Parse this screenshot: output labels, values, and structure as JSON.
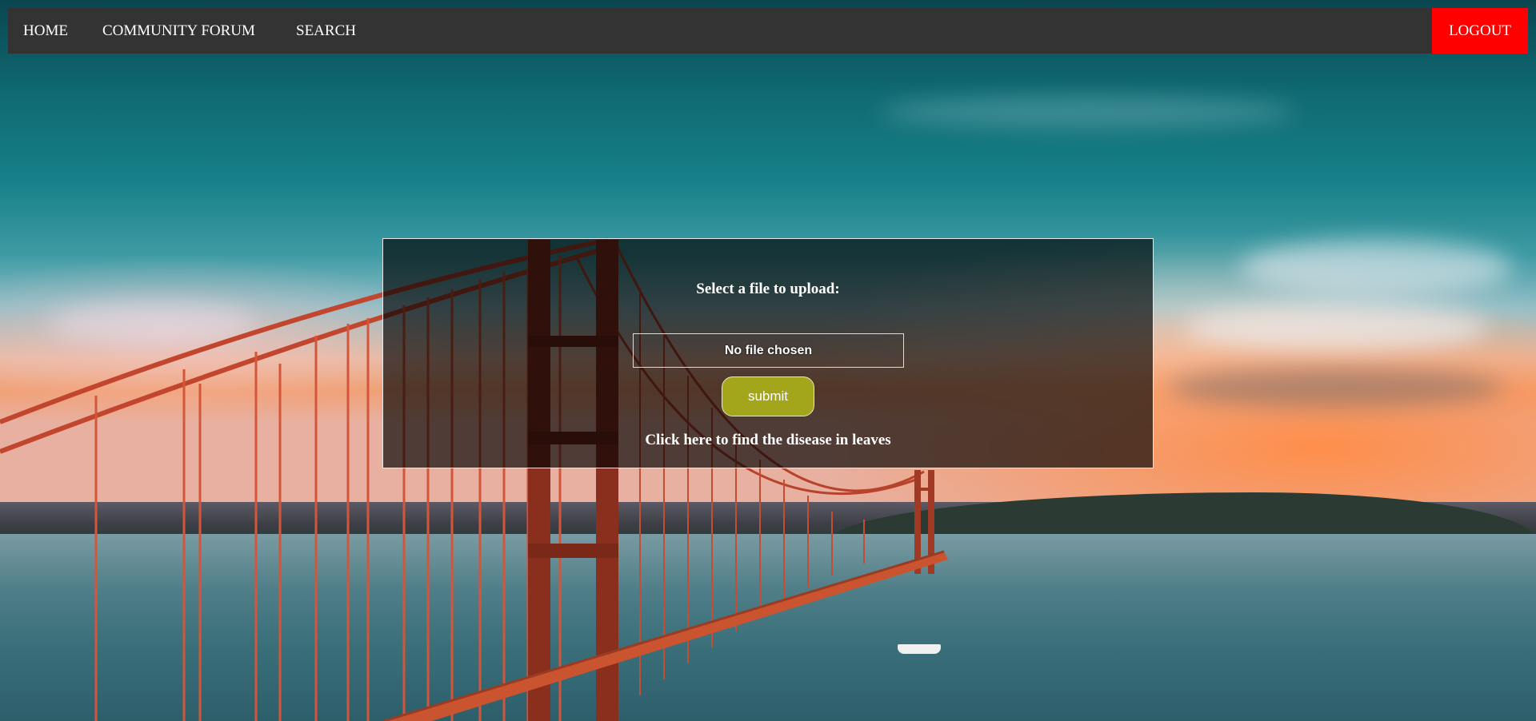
{
  "nav": {
    "home": "HOME",
    "community_forum": "COMMUNITY FORUM",
    "search": "SEARCH",
    "logout": "LOGOUT"
  },
  "upload": {
    "title": "Select a file to upload:",
    "file_status": "No file chosen",
    "submit_label": "submit",
    "disease_link": "Click here to find the disease in leaves"
  },
  "colors": {
    "navbar": "#333333",
    "logout": "#ff0000",
    "submit": "#a3a51a"
  },
  "background": {
    "icon": "golden-gate-bridge-photo"
  }
}
